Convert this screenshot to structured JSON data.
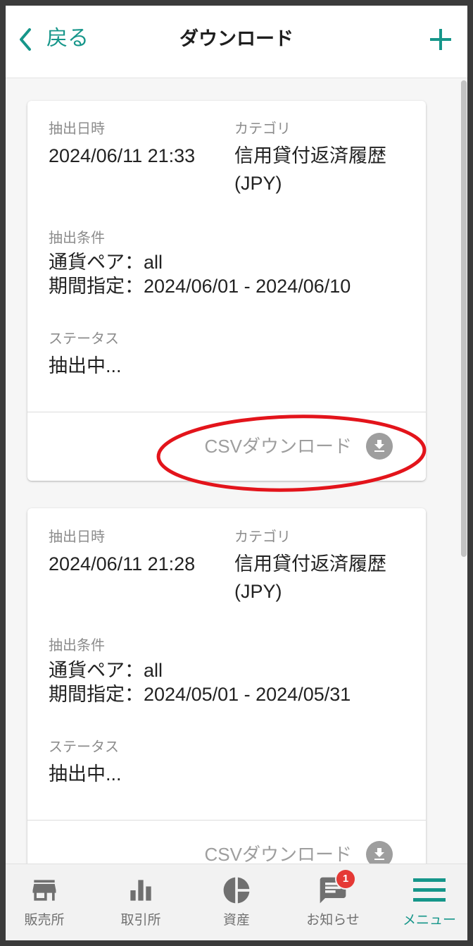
{
  "header": {
    "back_label": "戻る",
    "back_icon": "chevron-left-icon",
    "title": "ダウンロード",
    "add_icon": "plus-icon"
  },
  "records": [
    {
      "date_label": "抽出日時",
      "date": "2024/06/11 21:33",
      "category_label": "カテゴリ",
      "category": [
        "信用貸付返済履歴",
        "(JPY)"
      ],
      "conditions_label": "抽出条件",
      "conditions": [
        "通貨ペア：all",
        "期間指定：2024/06/01 - 2024/06/10"
      ],
      "status_label": "ステータス",
      "status": "抽出中...",
      "download_label": "CSVダウンロード",
      "download_icon": "download-circle-icon"
    },
    {
      "date_label": "抽出日時",
      "date": "2024/06/11 21:28",
      "category_label": "カテゴリ",
      "category": [
        "信用貸付返済履歴",
        "(JPY)"
      ],
      "conditions_label": "抽出条件",
      "conditions": [
        "通貨ペア：all",
        "期間指定：2024/05/01 - 2024/05/31"
      ],
      "status_label": "ステータス",
      "status": "抽出中...",
      "download_label": "CSVダウンロード",
      "download_icon": "download-circle-icon"
    }
  ],
  "bottom_nav": {
    "items": [
      {
        "label": "販売所",
        "icon": "store-icon"
      },
      {
        "label": "取引所",
        "icon": "bar-chart-icon"
      },
      {
        "label": "資産",
        "icon": "pie-chart-icon"
      },
      {
        "label": "お知らせ",
        "icon": "chat-icon",
        "badge": "1"
      },
      {
        "label": "メニュー",
        "icon": "menu-icon",
        "active": true
      }
    ]
  },
  "colors": {
    "accent": "#16968a",
    "badge": "#e53935",
    "annotation": "#e3141b",
    "muted": "#9e9e9e"
  }
}
